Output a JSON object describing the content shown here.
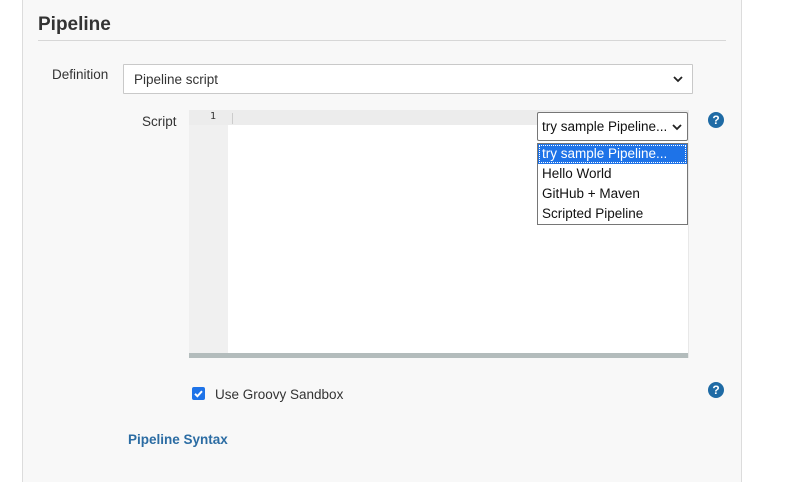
{
  "section": {
    "title": "Pipeline"
  },
  "definition": {
    "label": "Definition",
    "selected": "Pipeline script"
  },
  "script": {
    "label": "Script",
    "line_numbers": [
      "1"
    ],
    "sample_select": {
      "selected": "try sample Pipeline...",
      "options": [
        "try sample Pipeline...",
        "Hello World",
        "GitHub + Maven",
        "Scripted Pipeline"
      ]
    }
  },
  "sandbox": {
    "label": "Use Groovy Sandbox",
    "checked": true
  },
  "help": {
    "symbol": "?"
  },
  "links": {
    "pipeline_syntax": "Pipeline Syntax"
  },
  "colors": {
    "accent": "#1e73e8",
    "help": "#1f6ba5",
    "link": "#2b6ca3"
  }
}
